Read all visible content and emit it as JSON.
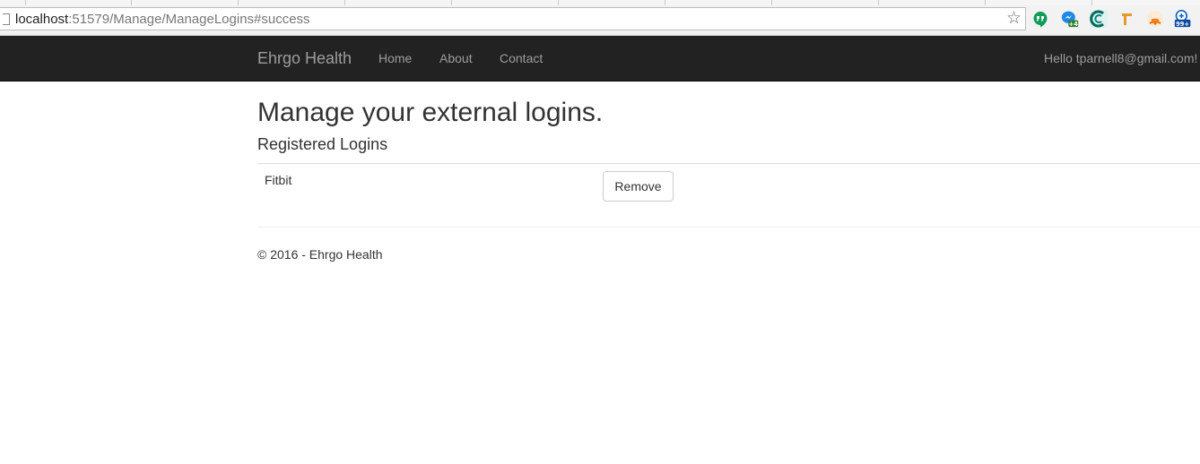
{
  "browser": {
    "url_host": "localhost",
    "url_rest": ":51579/Manage/ManageLogins#success",
    "extension_badges": {
      "messenger": "+4",
      "notifications": "99+"
    }
  },
  "navbar": {
    "brand": "Ehrgo Health",
    "links": [
      "Home",
      "About",
      "Contact"
    ],
    "greeting": "Hello tparnell8@gmail.com!"
  },
  "main": {
    "title": "Manage your external logins.",
    "section_title": "Registered Logins",
    "logins": [
      {
        "provider": "Fitbit",
        "action": "Remove"
      }
    ]
  },
  "footer": {
    "text": "© 2016 - Ehrgo Health"
  },
  "colors": {
    "navbar_bg": "#222222",
    "navbar_text": "#9d9d9d",
    "text": "#333333"
  }
}
